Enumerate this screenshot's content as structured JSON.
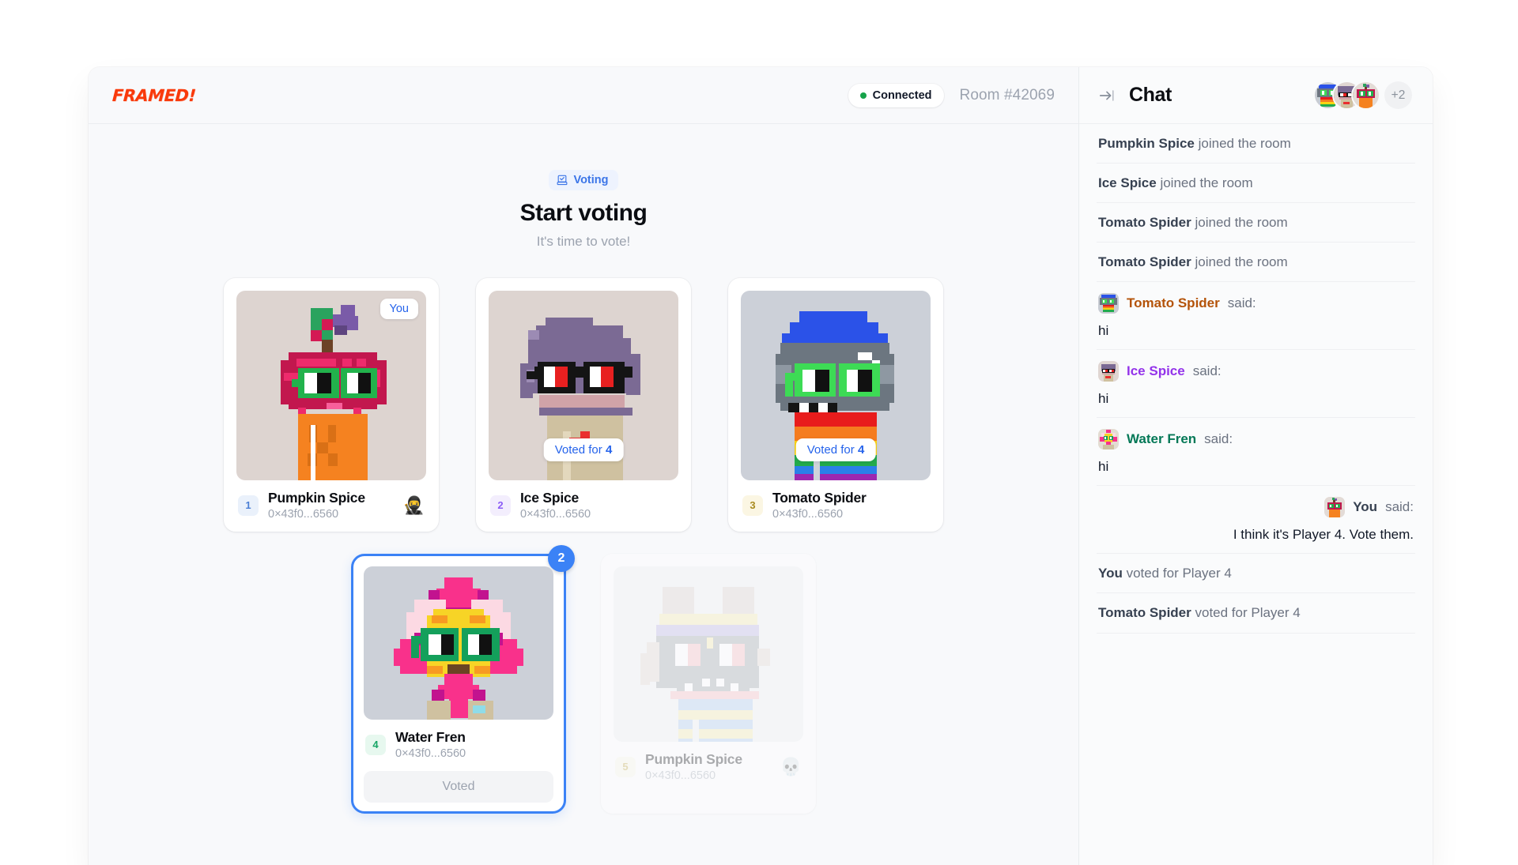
{
  "app": {
    "logo": "FRAMED!",
    "connection_label": "Connected",
    "room_label": "Room #42069",
    "accent_color": "#3b82f6",
    "logo_color": "#f93a0b",
    "connected_color": "#16a34a"
  },
  "game": {
    "status_badge": "Voting",
    "status_icon": "ballot-box-icon",
    "title": "Start voting",
    "subtitle": "It's time to vote!",
    "you_label": "You",
    "voted_button_label": "Voted",
    "players": [
      {
        "number": "1",
        "name": "Pumpkin Spice",
        "address": "0×43f0...6560",
        "badge": "You",
        "badge_type": "you",
        "emoji": "🥷",
        "emoji_name": "ninja-emoji",
        "state": "you"
      },
      {
        "number": "2",
        "name": "Ice Spice",
        "address": "0×43f0...6560",
        "badge": "Voted for 4",
        "badge_vote_target": "4",
        "badge_type": "voted-for",
        "emoji": "",
        "state": "alive"
      },
      {
        "number": "3",
        "name": "Tomato Spider",
        "address": "0×43f0...6560",
        "badge": "Voted for 4",
        "badge_vote_target": "4",
        "badge_type": "voted-for",
        "emoji": "",
        "state": "alive"
      },
      {
        "number": "4",
        "name": "Water Fren",
        "address": "0×43f0...6560",
        "vote_count": "2",
        "badge_type": "selected",
        "button_label": "Voted",
        "emoji": "",
        "state": "selected"
      },
      {
        "number": "5",
        "name": "Pumpkin Spice",
        "address": "0×43f0...6560",
        "badge_type": "eliminated",
        "emoji": "💀",
        "emoji_name": "skull-emoji",
        "state": "eliminated"
      }
    ]
  },
  "chat": {
    "title": "Chat",
    "collapse_icon": "collapse-panel-icon",
    "overflow_count": "+2",
    "name_colors": {
      "Tomato Spider": "#b45309",
      "Ice Spice": "#9333ea",
      "Water Fren": "#047857",
      "You": "#374151"
    },
    "messages": [
      {
        "type": "system",
        "actor": "Pumpkin Spice",
        "text": "joined the room"
      },
      {
        "type": "system",
        "actor": "Ice Spice",
        "text": "joined the room"
      },
      {
        "type": "system",
        "actor": "Tomato Spider",
        "text": "joined the room"
      },
      {
        "type": "system",
        "actor": "Tomato Spider",
        "text": "joined the room"
      },
      {
        "type": "said",
        "actor": "Tomato Spider",
        "suffix": "said:",
        "body": "hi",
        "align": "left",
        "avatar": "tomato-spider"
      },
      {
        "type": "said",
        "actor": "Ice Spice",
        "suffix": "said:",
        "body": "hi",
        "align": "left",
        "avatar": "ice-spice"
      },
      {
        "type": "said",
        "actor": "Water Fren",
        "suffix": "said:",
        "body": "hi",
        "align": "left",
        "avatar": "water-fren"
      },
      {
        "type": "said",
        "actor": "You",
        "suffix": "said:",
        "body": "I think it's Player 4. Vote them.",
        "align": "right",
        "avatar": "pumpkin-spice"
      },
      {
        "type": "system",
        "actor": "You",
        "text": "voted for Player 4"
      },
      {
        "type": "system",
        "actor": "Tomato Spider",
        "text": "voted for Player 4"
      }
    ]
  }
}
